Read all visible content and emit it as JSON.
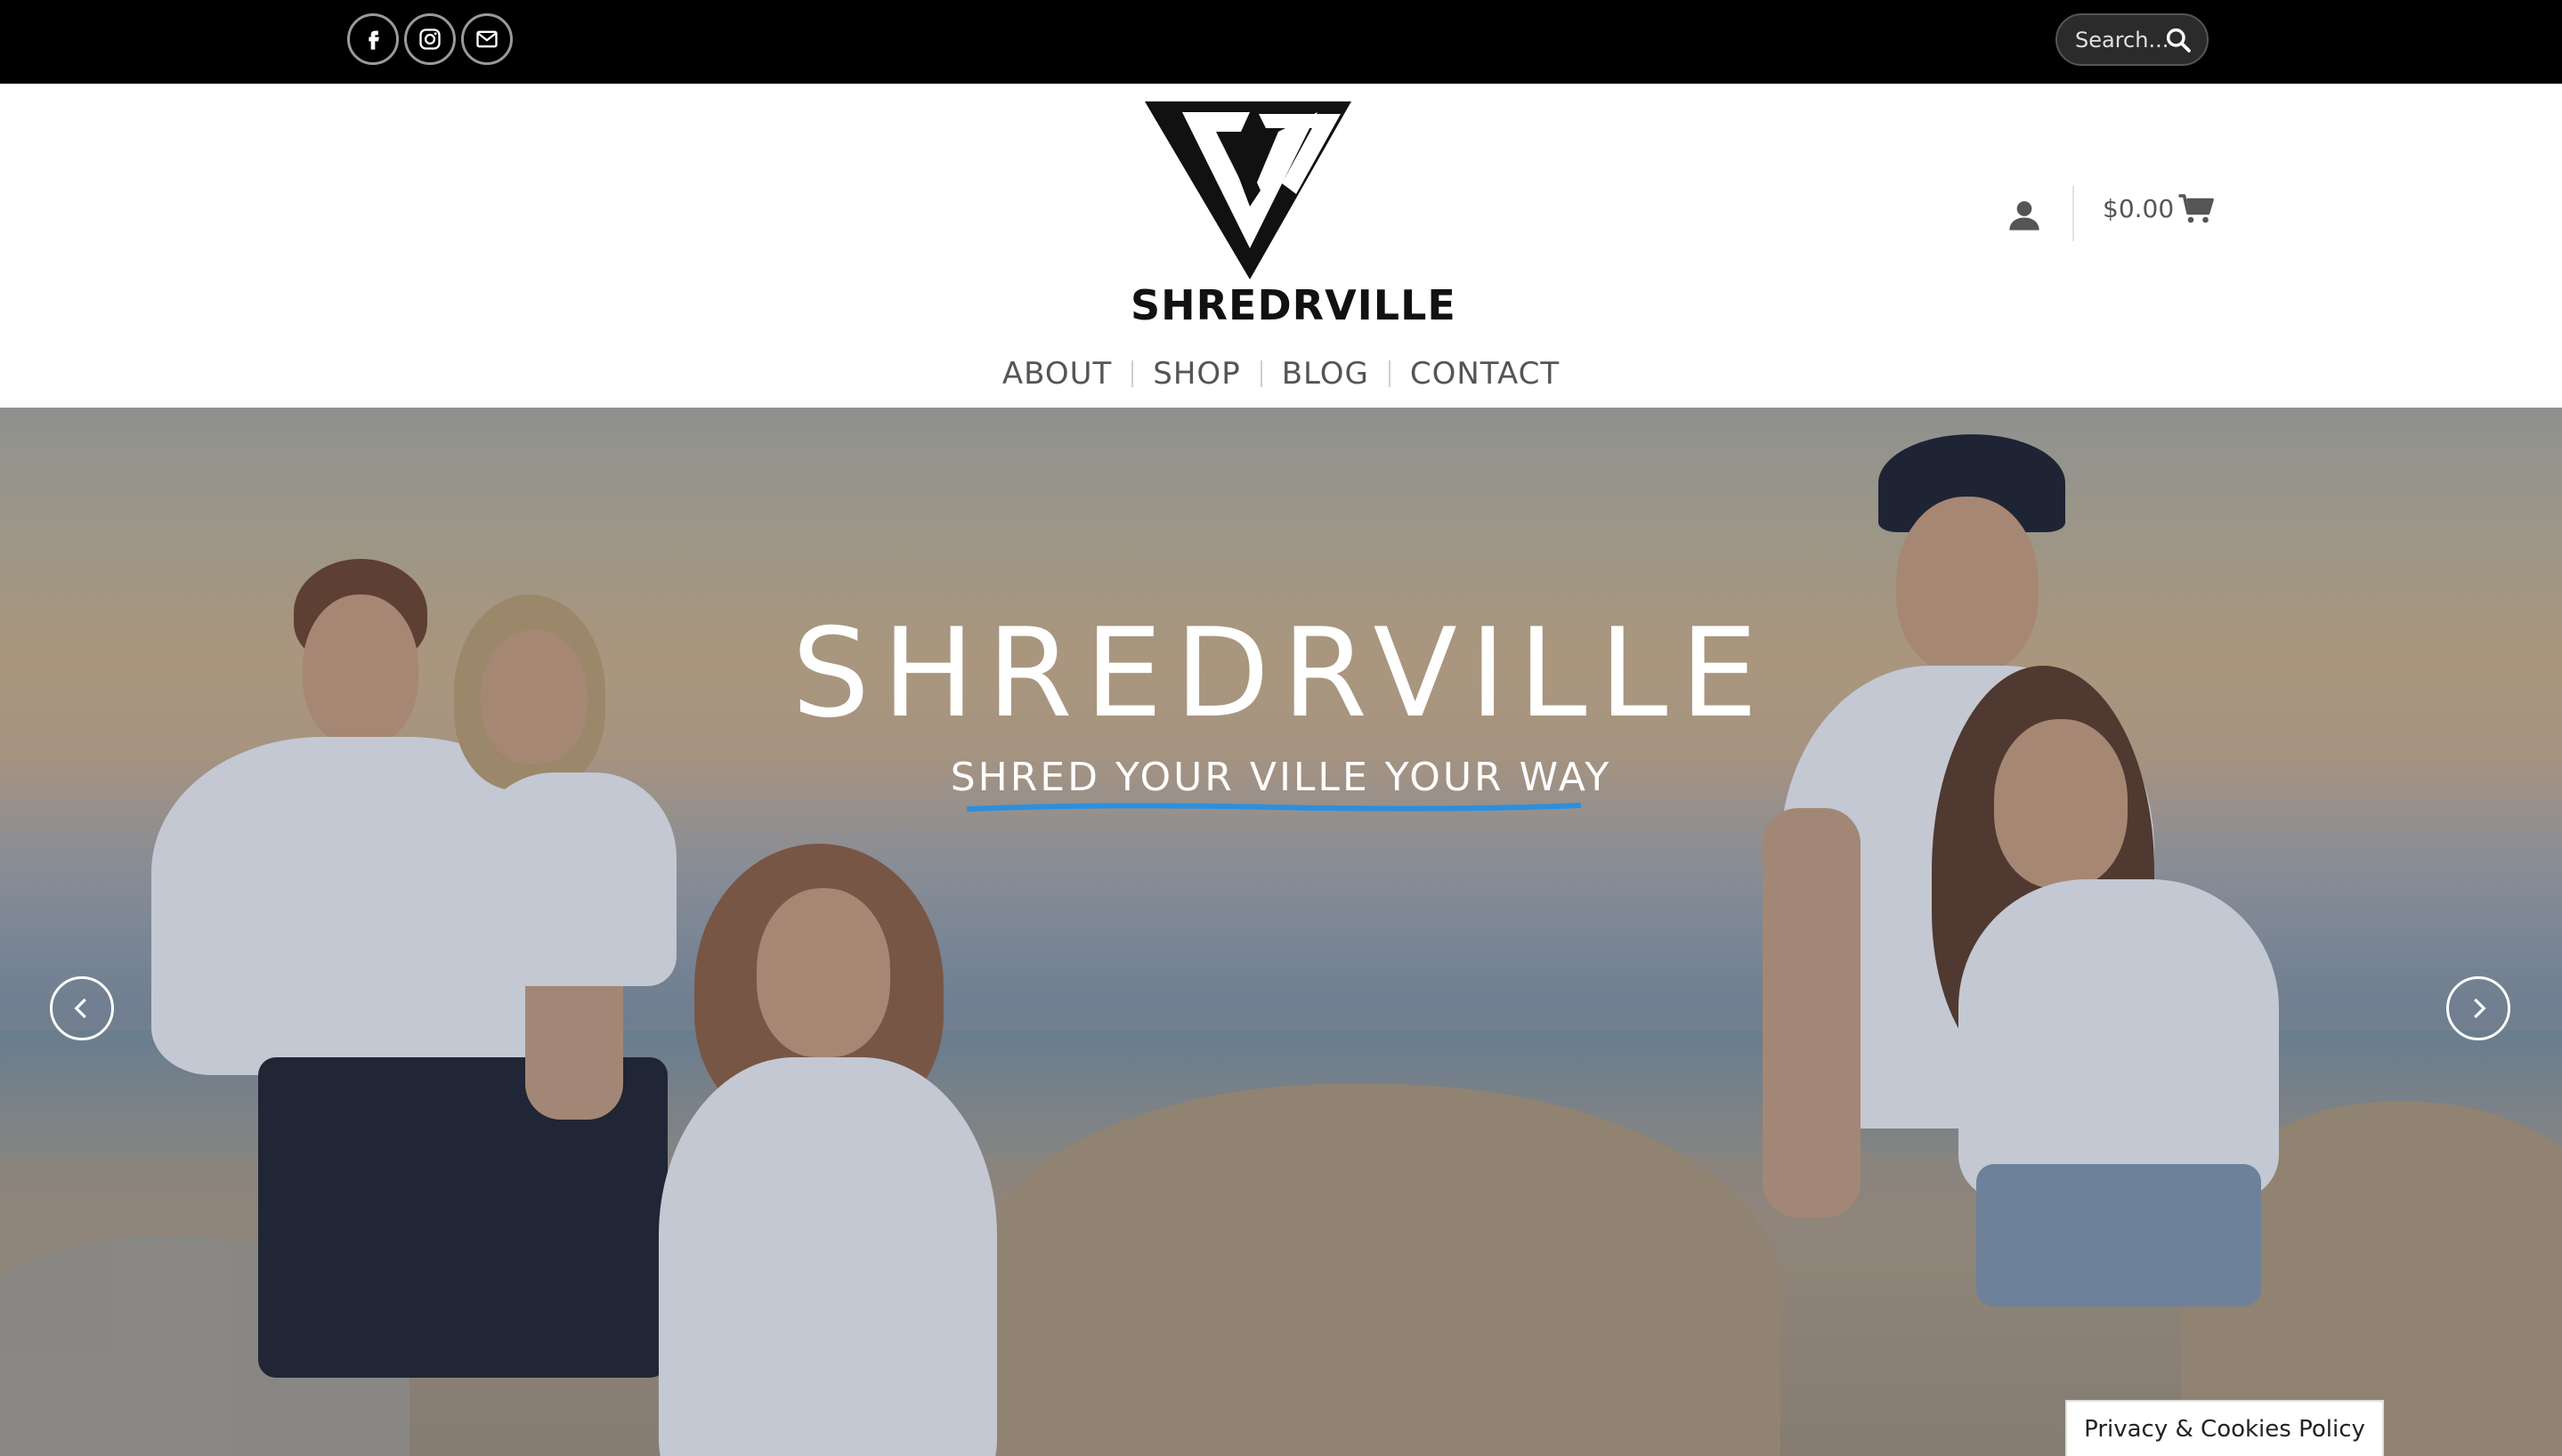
{
  "topbar": {
    "social": [
      {
        "name": "facebook-icon"
      },
      {
        "name": "instagram-icon"
      },
      {
        "name": "email-icon"
      }
    ],
    "search": {
      "placeholder": "Search...",
      "icon": "search-icon"
    }
  },
  "header": {
    "logo_text": "SHREDRVILLE",
    "account_icon": "user-icon",
    "cart_total": "$0.00",
    "cart_icon": "cart-icon"
  },
  "nav": {
    "items": [
      "ABOUT",
      "SHOP",
      "BLOG",
      "CONTACT"
    ]
  },
  "hero": {
    "title": "SHREDRVILLE",
    "subtitle": "SHRED YOUR VILLE YOUR WAY",
    "underline_color": "#2d8fdc",
    "prev_icon": "chevron-left-icon",
    "next_icon": "chevron-right-icon"
  },
  "cookie_bar": {
    "label": "Privacy & Cookies Policy"
  },
  "colors": {
    "topbar": "#000000",
    "nav_text": "#555555",
    "accent": "#2d8fdc"
  }
}
